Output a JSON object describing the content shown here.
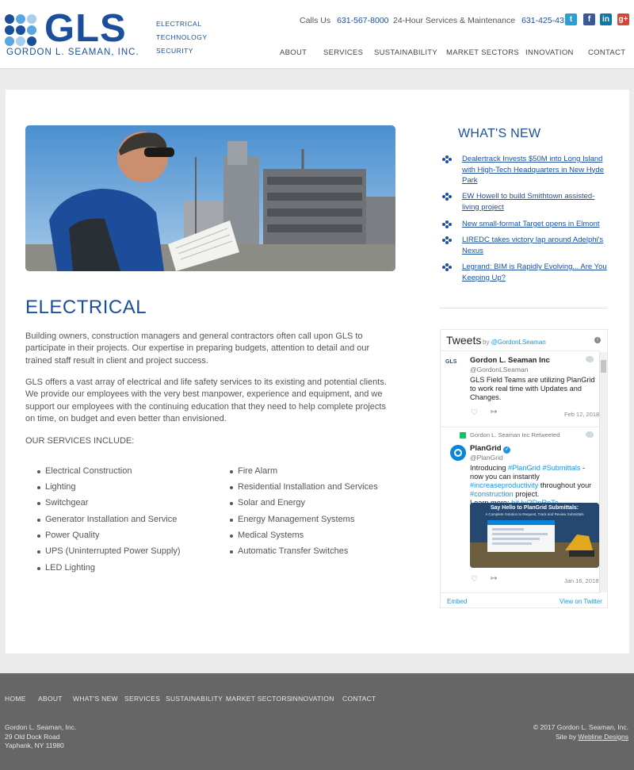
{
  "header": {
    "logo_text": "GLS",
    "company_name": "GORDON L. SEAMAN, INC.",
    "tagline": [
      "ELECTRICAL",
      "TECHNOLOGY",
      "SECURITY"
    ],
    "calls_label": "Calls Us",
    "calls_phone": "631-567-8000",
    "service_label": "24-Hour Services & Maintenance",
    "service_phone": "631-425-4317",
    "social": [
      {
        "name": "twitter-icon",
        "glyph": "t",
        "color": "#2a9fd6"
      },
      {
        "name": "facebook-icon",
        "glyph": "f",
        "color": "#3b5998"
      },
      {
        "name": "linkedin-icon",
        "glyph": "in",
        "color": "#0e76a8"
      },
      {
        "name": "googleplus-icon",
        "glyph": "g+",
        "color": "#d34836"
      }
    ],
    "nav": [
      "ABOUT",
      "SERVICES",
      "SUSTAINABILITY",
      "MARKET SECTORS",
      "INNOVATION",
      "CONTACT"
    ]
  },
  "main": {
    "title": "ELECTRICAL",
    "paragraphs": [
      "Building owners, construction managers and general contractors often call upon GLS to participate in their projects. Our expertise in preparing budgets, attention to detail and our trained staff result in client and project success.",
      "GLS offers a vast array of electrical and life safety services to its existing and potential clients. We provide our employees with the very best manpower, experience and equipment, and we support our employees with the continuing education that they need to help complete projects on time, on budget and even better than envisioned."
    ],
    "services_heading": "OUR SERVICES INCLUDE:",
    "services_left": [
      "Electrical Construction",
      "Lighting",
      "Switchgear",
      "Generator Installation and Service",
      "Power Quality",
      "UPS (Uninterrupted Power Supply)",
      "LED Lighting"
    ],
    "services_right": [
      "Fire Alarm",
      "Residential Installation and Services",
      "Solar and Energy",
      "Energy Management Systems",
      "Medical Systems",
      "Automatic Transfer Switches"
    ]
  },
  "whats_new": {
    "title": "WHAT'S NEW",
    "items": [
      "Dealertrack Invests $50M into Long Island with High-Tech Headquarters in New Hyde Park",
      "EW Howell to build Smithtown assisted-living project",
      "New small-format Target opens in Elmont",
      "LIREDC takes victory lap around Adelphi's Nexus",
      "Legrand: BIM is Rapidly Evolving... Are You Keeping Up?"
    ]
  },
  "tweets": {
    "title": "Tweets",
    "by": "by",
    "handle": "@GordonLSeaman",
    "tweet1": {
      "avatar": "GLS",
      "name": "Gordon L. Seaman Inc",
      "handle": "@GordonLSeaman",
      "text": "GLS Field Teams are utilizing PlanGrid to work real time with Updates and Changes.",
      "date": "Feb 12, 2018"
    },
    "tweet2": {
      "retweeted": "Gordon L. Seaman Inc Retweeted",
      "name": "PlanGrid",
      "handle": "@PlanGrid",
      "text_a": "Introducing",
      "tag1": "#PlanGrid",
      "tag2": "#Submittals",
      "text_b": "- now you can instantly",
      "tag3": "#increaseproductivity",
      "text_c": "throughout your",
      "tag4": "#construction",
      "text_d": "project.",
      "learn": "Learn more:",
      "link": "bit.ly/2DnRpTo",
      "card_title": "Say Hello to PlanGrid Submittals:",
      "card_sub": "A Complete Solution to Request, Track and Review Submittals",
      "date": "Jan 16, 2018"
    },
    "embed": "Embed",
    "view": "View on Twitter"
  },
  "footer": {
    "nav": [
      "HOME",
      "ABOUT",
      "WHAT'S NEW",
      "SERVICES",
      "SUSTAINABILITY",
      "MARKET SECTORS",
      "INNOVATION",
      "CONTACT"
    ],
    "address": [
      "Gordon L. Seaman, Inc.",
      "29 Old Dock Road",
      "Yaphank, NY 11980"
    ],
    "copyright": "© 2017 Gordon L. Seaman, Inc.",
    "site_by": "Site by",
    "designer": "Webline Designs"
  },
  "colors": {
    "brand": "#1b4f9c",
    "twitter": "#1b95e0",
    "footer": "#666666"
  }
}
